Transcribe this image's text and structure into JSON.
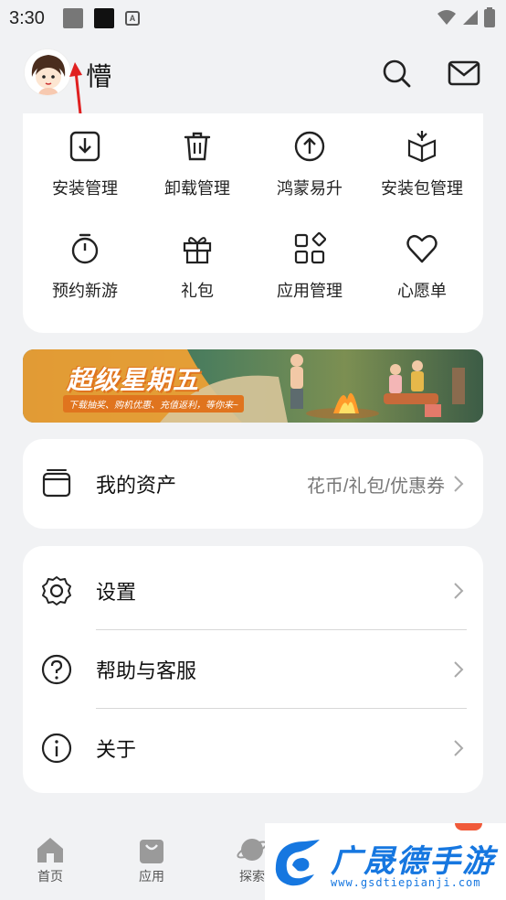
{
  "status_bar": {
    "time": "3:30",
    "a_badge": "A"
  },
  "header": {
    "username": "懵"
  },
  "quick_grid": [
    {
      "label": "安装管理",
      "icon": "download-box-icon"
    },
    {
      "label": "卸载管理",
      "icon": "trash-icon"
    },
    {
      "label": "鸿蒙易升",
      "icon": "upgrade-circle-icon"
    },
    {
      "label": "安装包管理",
      "icon": "package-icon"
    },
    {
      "label": "预约新游",
      "icon": "stopwatch-icon"
    },
    {
      "label": "礼包",
      "icon": "gift-icon"
    },
    {
      "label": "应用管理",
      "icon": "apps-grid-icon"
    },
    {
      "label": "心愿单",
      "icon": "heart-icon"
    }
  ],
  "banner": {
    "title": "超级星期五",
    "subtitle": "下载抽奖、购机优惠、充值返利，等你来~"
  },
  "assets": {
    "label": "我的资产",
    "value": "花币/礼包/优惠券"
  },
  "menu": [
    {
      "label": "设置",
      "icon": "gear-icon"
    },
    {
      "label": "帮助与客服",
      "icon": "help-icon"
    },
    {
      "label": "关于",
      "icon": "info-icon"
    }
  ],
  "bottom_nav": [
    {
      "label": "首页",
      "icon": "home-icon"
    },
    {
      "label": "应用",
      "icon": "bag-icon"
    },
    {
      "label": "探索",
      "icon": "planet-icon"
    }
  ],
  "watermark": {
    "text": "广晟德手游",
    "url": "www.gsdtiepianji.com"
  },
  "colors": {
    "background": "#f1f2f4",
    "card": "#ffffff",
    "watermark_blue": "#1677e0",
    "annotation_red": "#e02020"
  }
}
